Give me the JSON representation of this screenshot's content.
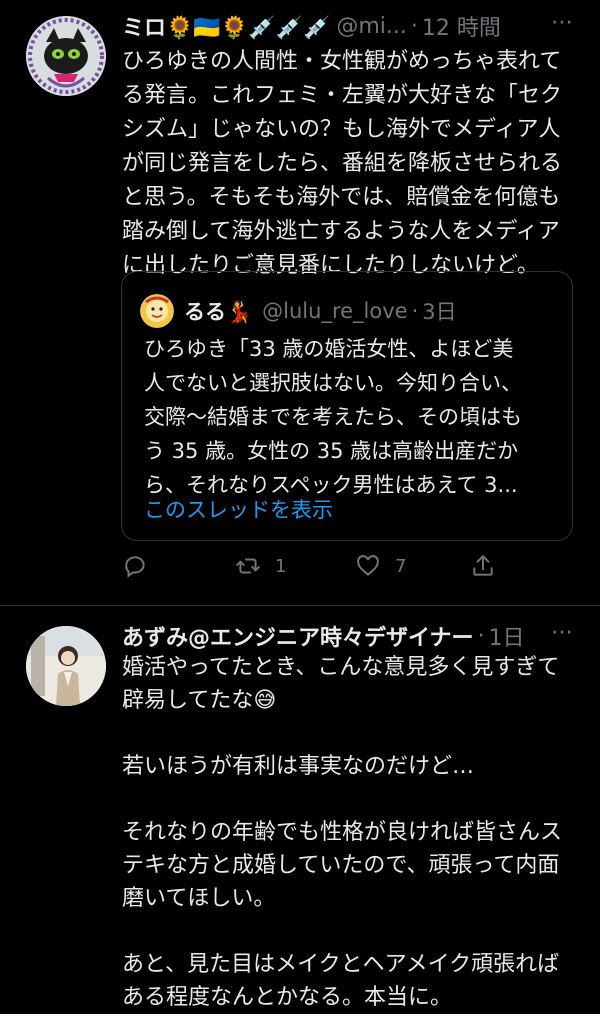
{
  "tweets": [
    {
      "name": "ミロ🌻🇺🇦🌻💉💉💉",
      "handle": "@mi...",
      "time": "12 時間",
      "text": "ひろゆきの人間性・女性観がめっちゃ表れて\nる発言。これフェミ・左翼が大好きな「セク\nシズム」じゃないの？もし海外でメディア人\nが同じ発言をしたら、番組を降板させられる\nと思う。そもそも海外では、賠償金を何億も\n踏み倒して海外逃亡するような人をメディア\nに出したりご意見番にしたりしないけど。",
      "quote": {
        "name": "るる💃",
        "handle": "@lulu_re_love",
        "time": "3日",
        "text": "ひろゆき「33 歳の婚活女性、よほど美\n人でないと選択肢はない。今知り合い、\n交際〜結婚までを考えたら、その頃はも\nう 35 歳。女性の 35 歳は高齢出産だか\nら、それなりスペック男性はあえて 3...",
        "show_thread": "このスレッドを表示"
      },
      "retweets": "1",
      "likes": "7"
    },
    {
      "name": "あずみ@エンジニア時々デザイナー",
      "time": "1日",
      "text": "婚活やってたとき、こんな意見多く見すぎて\n辟易してたな😅\n\n若いほうが有利は事実なのだけど…\n\nそれなりの年齢でも性格が良ければ皆さんス\nテキな方と成婚していたので、頑張って内面\n磨いてほしい。\n\nあと、見た目はメイクとヘアメイク頑張れば\nある程度なんとかなる。本当に。"
    }
  ],
  "more_label": "⋯",
  "dot_label": "·",
  "icons": {
    "reply": "reply-icon",
    "retweet": "retweet-icon",
    "like": "heart-icon",
    "share": "share-icon"
  },
  "colors": {
    "background": "#000000",
    "text": "#e7e9ea",
    "muted": "#71767b",
    "link": "#1d9bf0",
    "border": "#2f3336"
  }
}
